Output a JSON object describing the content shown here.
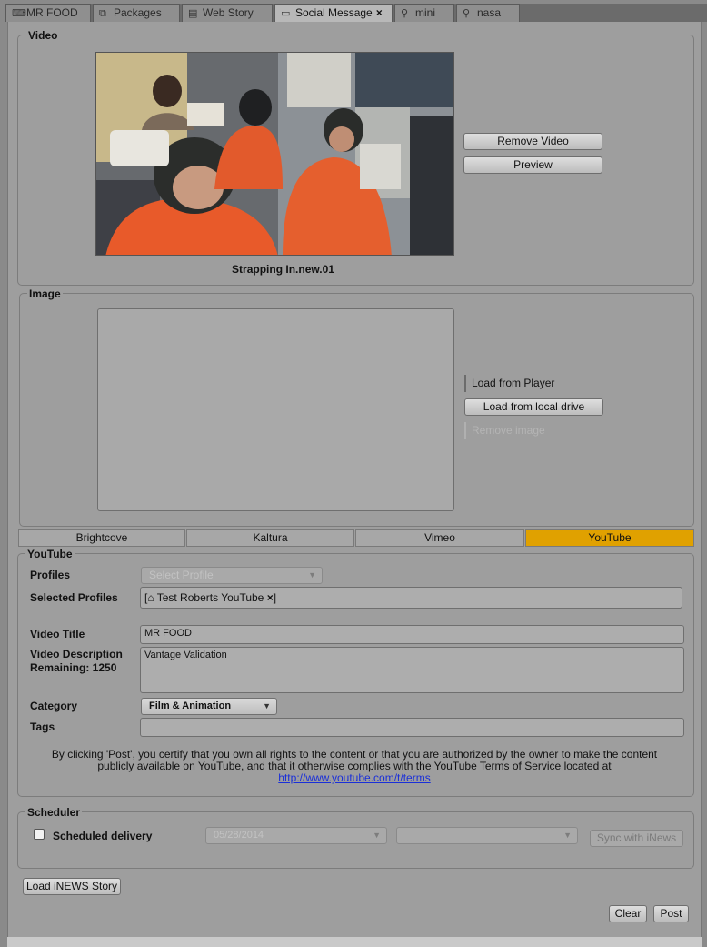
{
  "tabs": [
    {
      "label": "MR FOOD",
      "icon": "keyboard-icon"
    },
    {
      "label": "Packages",
      "icon": "packages-icon"
    },
    {
      "label": "Web Story",
      "icon": "document-icon"
    },
    {
      "label": "Social Message",
      "icon": "message-icon",
      "close": "×"
    },
    {
      "label": "mini",
      "icon": "search-icon"
    },
    {
      "label": "nasa",
      "icon": "search-icon"
    }
  ],
  "video": {
    "legend": "Video",
    "remove_label": "Remove Video",
    "preview_label": "Preview",
    "caption": "Strapping In.new.01"
  },
  "image": {
    "legend": "Image",
    "load_player_label": "Load from Player",
    "load_local_label": "Load from local drive",
    "remove_label": "Remove image"
  },
  "providers": [
    "Brightcove",
    "Kaltura",
    "Vimeo",
    "YouTube"
  ],
  "youtube": {
    "legend": "YouTube",
    "profiles_label": "Profiles",
    "profiles_placeholder": "Select Profile",
    "selected_profiles_label": "Selected Profiles",
    "selected_profile": "Test Roberts YouTube",
    "video_title_label": "Video Title",
    "video_title_value": "MR FOOD",
    "video_description_label": "Video Description",
    "remaining_label": "Remaining: 1250",
    "video_description_value": "Vantage Validation",
    "category_label": "Category",
    "category_value": "Film & Animation",
    "tags_label": "Tags",
    "tags_value": "",
    "terms_text": "By clicking 'Post', you certify that you own all rights to the content or that you are authorized by the owner to make the content publicly available on YouTube, and that it otherwise complies with the YouTube Terms of Service located at",
    "terms_link": "http://www.youtube.com/t/terms"
  },
  "scheduler": {
    "legend": "Scheduler",
    "scheduled_label": "Scheduled delivery",
    "date_value": "05/28/2014",
    "time_value": "",
    "sync_label": "Sync with iNews"
  },
  "actions": {
    "load_inews_label": "Load iNEWS Story",
    "clear_label": "Clear",
    "post_label": "Post"
  },
  "colors": {
    "active_provider": "#e0a100",
    "link": "#1a2fd8"
  }
}
